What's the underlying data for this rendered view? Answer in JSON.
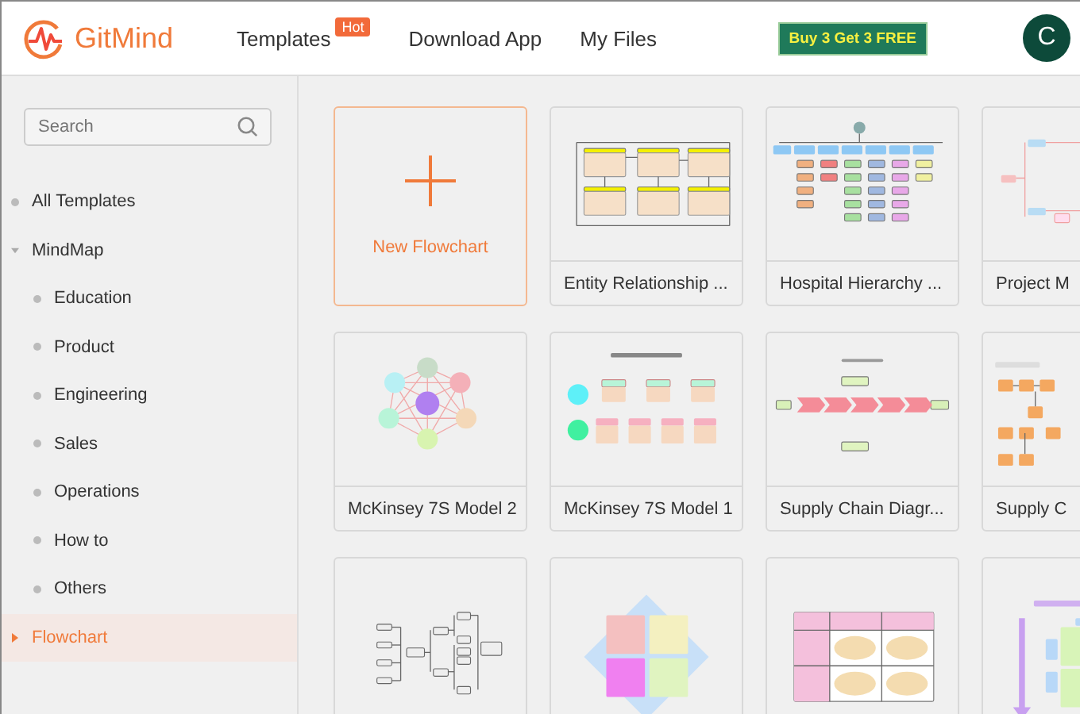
{
  "header": {
    "logo": "GitMind",
    "nav": [
      {
        "label": "Templates",
        "badge": "Hot"
      },
      {
        "label": "Download App"
      },
      {
        "label": "My Files"
      }
    ],
    "promo": "Buy 3 Get 3 FREE",
    "avatar": "C"
  },
  "sidebar": {
    "search": {
      "placeholder": "Search"
    },
    "items": [
      {
        "label": "All Templates",
        "selected": false
      },
      {
        "label": "MindMap",
        "selected": false,
        "expanded": true,
        "children": [
          {
            "label": "Education",
            "selected": false
          },
          {
            "label": "Product",
            "selected": false
          },
          {
            "label": "Engineering",
            "selected": false
          },
          {
            "label": "Sales",
            "selected": false
          },
          {
            "label": "Operations",
            "selected": false
          },
          {
            "label": "How to",
            "selected": false
          },
          {
            "label": "Others",
            "selected": false
          }
        ]
      },
      {
        "label": "Flowchart",
        "selected": true,
        "expanded": false
      }
    ]
  },
  "new_card": {
    "label": "New Flowchart"
  },
  "templates": [
    {
      "title": "Entity Relationship ...",
      "kind": "er"
    },
    {
      "title": "Hospital Hierarchy ...",
      "kind": "org"
    },
    {
      "title": "Project M",
      "kind": "flowh"
    },
    {
      "title": "McKinsey 7S Model 2",
      "kind": "network"
    },
    {
      "title": "McKinsey 7S Model 1",
      "kind": "seven"
    },
    {
      "title": "Supply Chain Diagr...",
      "kind": "chain"
    },
    {
      "title": "Supply C",
      "kind": "flowv"
    },
    {
      "kind": "tree"
    },
    {
      "kind": "quadrant"
    },
    {
      "kind": "table"
    },
    {
      "kind": "timeline"
    }
  ]
}
